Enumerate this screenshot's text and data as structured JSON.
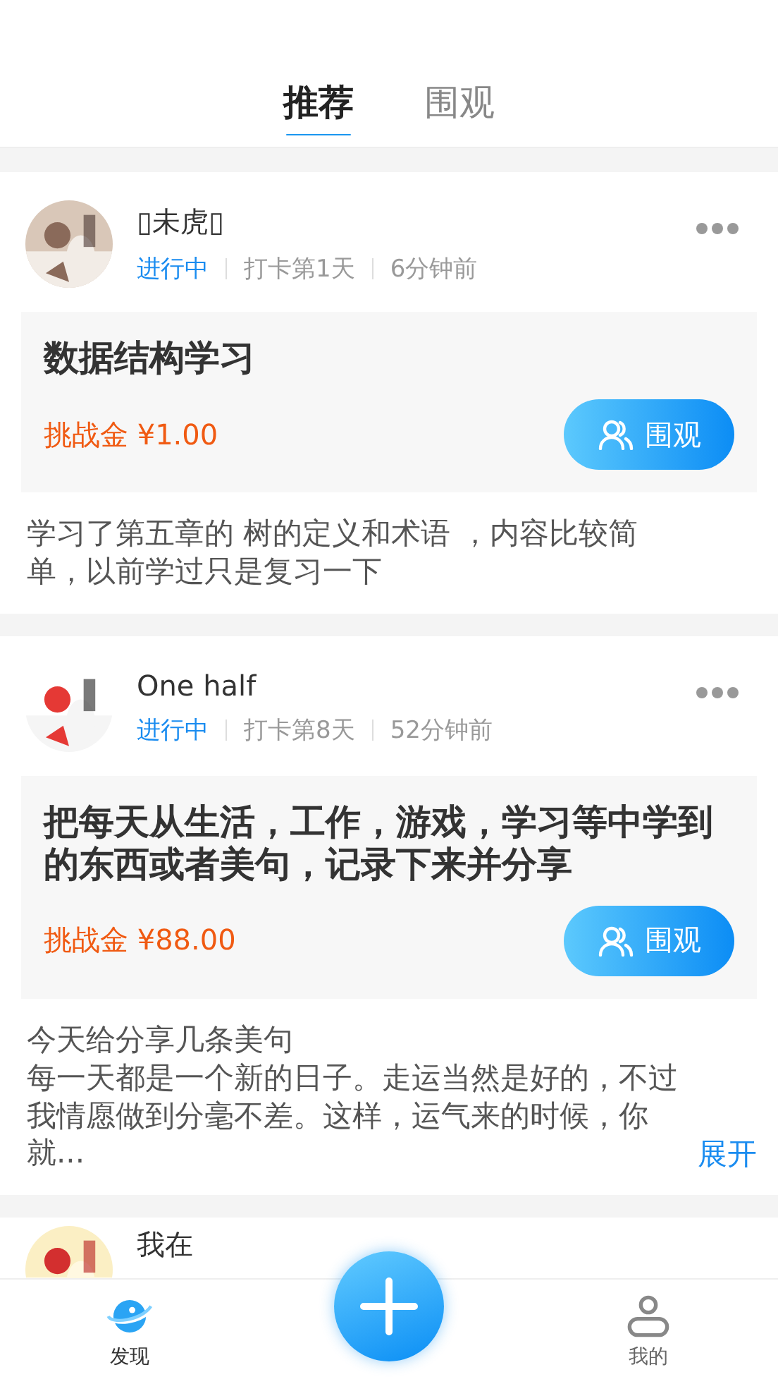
{
  "tabs": [
    {
      "label": "推荐",
      "selected": true
    },
    {
      "label": "围观",
      "selected": false
    }
  ],
  "posts": [
    {
      "name": "▯未虎▯",
      "status": "进行中",
      "day": "打卡第1天",
      "time": "6分钟前",
      "title": "数据结构学习",
      "prize": "挑战金 ¥1.00",
      "watch_label": "围观",
      "body": "学习了第五章的 树的定义和术语 ，内容比较简单，以前学过只是复习一下"
    },
    {
      "name": "One half",
      "status": "进行中",
      "day": "打卡第8天",
      "time": "52分钟前",
      "title": "把每天从生活，工作，游戏，学习等中学到的东西或者美句，记录下来并分享",
      "prize": "挑战金 ¥88.00",
      "watch_label": "围观",
      "body": "今天给分享几条美句",
      "body_more": "每一天都是一个新的日子。走运当然是好的，不过我情愿做到分毫不差。这样，运气来的时候，你就...",
      "expand_label": "展开"
    },
    {
      "name": "我在"
    }
  ],
  "nav": [
    {
      "label": "发现",
      "selected": true,
      "kind": "discover"
    },
    {
      "kind": "add"
    },
    {
      "label": "我的",
      "selected": false,
      "kind": "profile"
    }
  ]
}
